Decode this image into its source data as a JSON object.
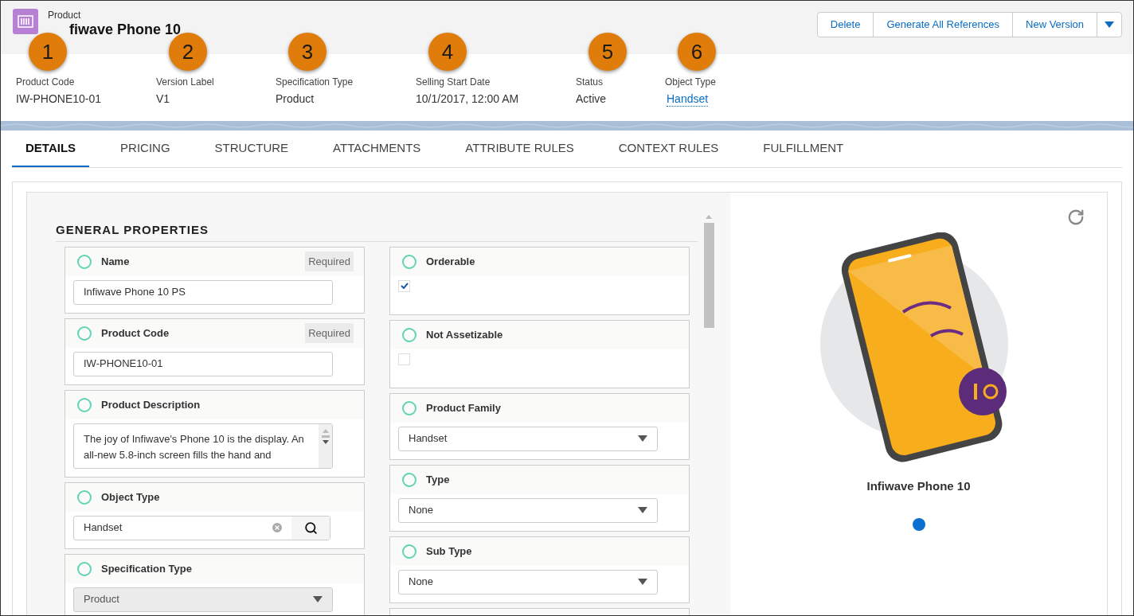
{
  "header": {
    "object_label": "Product",
    "title": "fiwave Phone 10",
    "actions": [
      "Delete",
      "Generate All References",
      "New Version"
    ]
  },
  "highlights": [
    {
      "label": "Product Code",
      "value": "IW-PHONE10-01",
      "kind": "text",
      "callout": "1"
    },
    {
      "label": "Version Label",
      "value": "V1",
      "kind": "text",
      "callout": "2"
    },
    {
      "label": "Specification Type",
      "value": "Product",
      "kind": "text",
      "callout": "3"
    },
    {
      "label": "Selling Start Date",
      "value": "10/1/2017, 12:00 AM",
      "kind": "text",
      "callout": "4"
    },
    {
      "label": "Status",
      "value": "Active",
      "kind": "text",
      "callout": "5"
    },
    {
      "label": "Object Type",
      "value": "Handset",
      "kind": "link",
      "callout": "6"
    }
  ],
  "tabs": [
    {
      "label": "DETAILS",
      "selected": true
    },
    {
      "label": "PRICING",
      "selected": false
    },
    {
      "label": "STRUCTURE",
      "selected": false
    },
    {
      "label": "ATTACHMENTS",
      "selected": false
    },
    {
      "label": "ATTRIBUTE RULES",
      "selected": false
    },
    {
      "label": "CONTEXT RULES",
      "selected": false
    },
    {
      "label": "FULFILLMENT",
      "selected": false
    }
  ],
  "section_title": "GENERAL PROPERTIES",
  "columns": [
    [
      {
        "label": "Name",
        "kind": "text",
        "value": "Infiwave Phone 10 PS",
        "badge": "Required"
      },
      {
        "label": "Product Code",
        "kind": "text",
        "value": "IW-PHONE10-01",
        "badge": "Required"
      },
      {
        "label": "Product Description",
        "kind": "textarea",
        "value": "The joy of Infiwave's Phone 10 is the display. An all-new 5.8-inch screen fills the hand and"
      },
      {
        "label": "Object Type",
        "kind": "lookup",
        "value": "Handset"
      },
      {
        "label": "Specification Type",
        "kind": "select",
        "value": "Product",
        "disabled": true
      }
    ],
    [
      {
        "label": "Orderable",
        "kind": "checkbox",
        "checked": true
      },
      {
        "label": "Not Assetizable",
        "kind": "checkbox",
        "checked": false
      },
      {
        "label": "Product Family",
        "kind": "select",
        "value": "Handset",
        "disabled": false
      },
      {
        "label": "Type",
        "kind": "select",
        "value": "None",
        "disabled": false
      },
      {
        "label": "Sub Type",
        "kind": "select",
        "value": "None",
        "disabled": false
      },
      {
        "kind": "stub"
      }
    ]
  ],
  "preview": {
    "caption": "Infiwave Phone 10",
    "dots": [
      {
        "selected": true
      }
    ]
  }
}
